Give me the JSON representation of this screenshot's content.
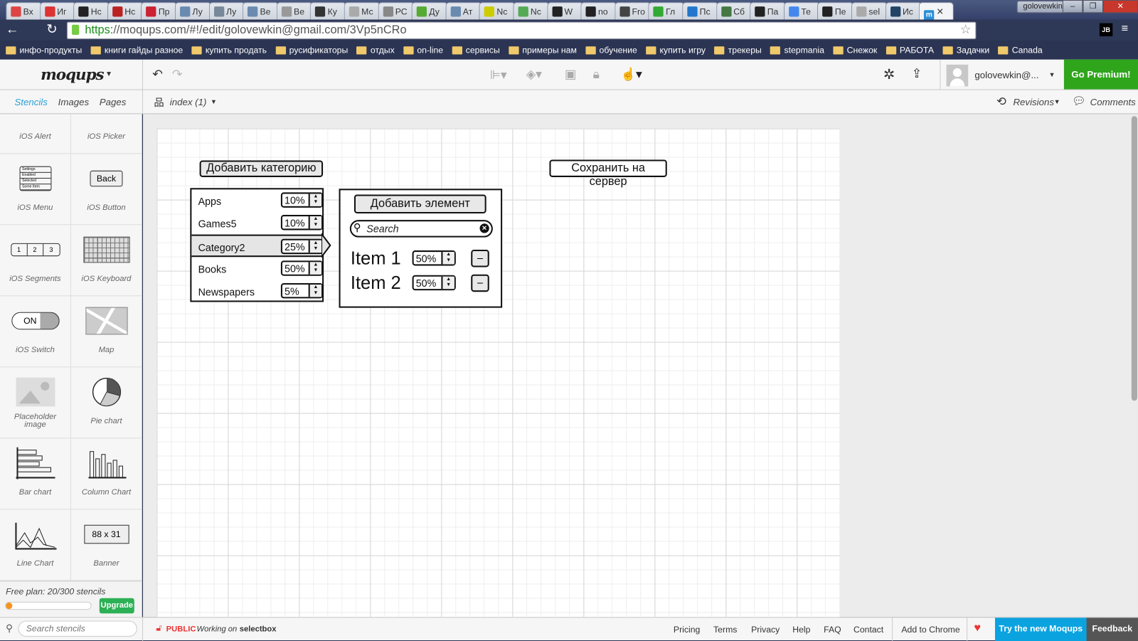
{
  "browser": {
    "tabs": [
      {
        "label": "Вх",
        "color": "#d44"
      },
      {
        "label": "Иг",
        "color": "#d33"
      },
      {
        "label": "Нс",
        "color": "#222"
      },
      {
        "label": "Нс",
        "color": "#b22"
      },
      {
        "label": "Пр",
        "color": "#c23"
      },
      {
        "label": "Лу",
        "color": "#6a8ab0"
      },
      {
        "label": "Лу",
        "color": "#789"
      },
      {
        "label": "Ве",
        "color": "#6a8ab0"
      },
      {
        "label": "Ве",
        "color": "#999"
      },
      {
        "label": "Ку",
        "color": "#333"
      },
      {
        "label": "Мс",
        "color": "#aaa"
      },
      {
        "label": "РС",
        "color": "#888"
      },
      {
        "label": "Ду",
        "color": "#5a3"
      },
      {
        "label": "Ат",
        "color": "#6a8ab0"
      },
      {
        "label": "Nc",
        "color": "#cc0"
      },
      {
        "label": "Nc",
        "color": "#5a5"
      },
      {
        "label": "W",
        "color": "#222"
      },
      {
        "label": "no",
        "color": "#222"
      },
      {
        "label": "Fro",
        "color": "#444"
      },
      {
        "label": "Гл",
        "color": "#3a3"
      },
      {
        "label": "Пс",
        "color": "#27c"
      },
      {
        "label": "Сб",
        "color": "#474"
      },
      {
        "label": "Па",
        "color": "#222"
      },
      {
        "label": "Те",
        "color": "#48e"
      },
      {
        "label": "Пе",
        "color": "#222"
      },
      {
        "label": "sel",
        "color": "#aaa"
      },
      {
        "label": "Ис",
        "color": "#246"
      },
      {
        "label": "m",
        "color": "#2a8fd8",
        "active": true
      }
    ],
    "window_user": "golovewkin",
    "url_scheme": "https",
    "url_rest": "://moqups.com/#!/edit/golovewkin@gmail.com/3Vp5nCRo",
    "bookmarks": [
      "инфо-продукты",
      "книги гайды разное",
      "купить продать",
      "русификаторы",
      "отдых",
      "on-line",
      "сервисы",
      "примеры нам",
      "обучение",
      "купить игру",
      "трекеры",
      "stepmania",
      "Снежок",
      "РАБОТА",
      "Задачки",
      "Canada"
    ]
  },
  "app": {
    "logo": "moqups",
    "user": "golovewkin@...",
    "premium": "Go Premium!",
    "panel_tabs": [
      "Stencils",
      "Images",
      "Pages"
    ],
    "page_selector": "index (1)",
    "revisions": "Revisions",
    "comments": "Comments",
    "accent": "#2fa51c"
  },
  "stencils": [
    {
      "label": "iOS Alert"
    },
    {
      "label": "iOS Picker"
    },
    {
      "label": "iOS Menu",
      "menu": [
        "Settings",
        "Enabled",
        "Selected",
        "Some Item"
      ]
    },
    {
      "label": "iOS Button",
      "text": "Back"
    },
    {
      "label": "iOS Segments",
      "segs": [
        "1",
        "2",
        "3"
      ]
    },
    {
      "label": "iOS Keyboard"
    },
    {
      "label": "iOS Switch",
      "text": "ON"
    },
    {
      "label": "Map"
    },
    {
      "label": "Placeholder image"
    },
    {
      "label": "Pie chart"
    },
    {
      "label": "Bar chart"
    },
    {
      "label": "Column Chart"
    },
    {
      "label": "Line Chart"
    },
    {
      "label": "Banner",
      "text": "88 x 31"
    }
  ],
  "plan": {
    "text": "Free plan: 20/300 stencils",
    "progress": 0.067,
    "upgrade": "Upgrade",
    "search_placeholder": "Search stencils"
  },
  "canvas": {
    "add_category": "Добавить категорию",
    "save_server": "Сохранить на сервер",
    "categories": [
      {
        "name": "Apps",
        "value": "10%"
      },
      {
        "name": "Games5",
        "value": "10%"
      },
      {
        "name": "Category2",
        "value": "25%",
        "selected": true
      },
      {
        "name": "Books",
        "value": "50%"
      },
      {
        "name": "Newspapers",
        "value": "5%"
      }
    ],
    "add_element": "Добавить элемент",
    "search_placeholder": "Search",
    "items": [
      {
        "name": "Item 1",
        "value": "50%"
      },
      {
        "name": "Item 2",
        "value": "50%"
      }
    ],
    "minus": "–"
  },
  "footer": {
    "public": "PUBLIC",
    "working": "Working on",
    "project": "selectbox",
    "links": [
      "Pricing",
      "Terms",
      "Privacy",
      "Help",
      "FAQ",
      "Contact"
    ],
    "add_chrome": "Add to Chrome",
    "try_new": "Try the new Moqups",
    "feedback": "Feedback"
  }
}
